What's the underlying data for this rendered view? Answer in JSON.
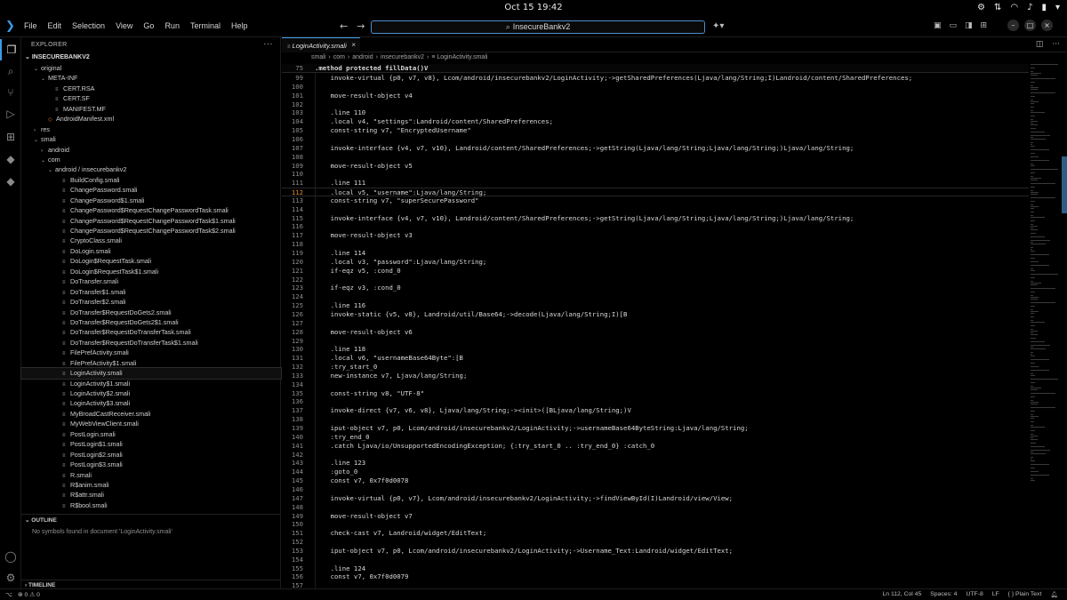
{
  "system": {
    "clock": "Oct 15  19:42",
    "tray_icons": [
      "notifications-icon",
      "network-icon",
      "wifi-icon",
      "volume-icon",
      "battery-icon",
      "menu-icon"
    ]
  },
  "menu": [
    "File",
    "Edit",
    "Selection",
    "View",
    "Go",
    "Run",
    "Terminal",
    "Help"
  ],
  "search": {
    "text": "InsecureBankv2"
  },
  "sidebar": {
    "header": "EXPLORER",
    "project": "INSECUREBANKV2",
    "tree": [
      {
        "label": "original",
        "depth": 1,
        "type": "folder",
        "open": true
      },
      {
        "label": "META-INF",
        "depth": 2,
        "type": "folder",
        "open": true
      },
      {
        "label": "CERT.RSA",
        "depth": 3,
        "type": "file"
      },
      {
        "label": "CERT.SF",
        "depth": 3,
        "type": "file"
      },
      {
        "label": "MANIFEST.MF",
        "depth": 3,
        "type": "file"
      },
      {
        "label": "AndroidManifest.xml",
        "depth": 2,
        "type": "xml"
      },
      {
        "label": "res",
        "depth": 1,
        "type": "folder",
        "open": false
      },
      {
        "label": "smali",
        "depth": 1,
        "type": "folder",
        "open": true
      },
      {
        "label": "android",
        "depth": 2,
        "type": "folder",
        "open": false
      },
      {
        "label": "com",
        "depth": 2,
        "type": "folder",
        "open": true
      },
      {
        "label": "android / insecurebankv2",
        "depth": 3,
        "type": "folder",
        "open": true
      },
      {
        "label": "BuildConfig.smali",
        "depth": 4,
        "type": "file"
      },
      {
        "label": "ChangePassword.smali",
        "depth": 4,
        "type": "file"
      },
      {
        "label": "ChangePassword$1.smali",
        "depth": 4,
        "type": "file"
      },
      {
        "label": "ChangePassword$RequestChangePasswordTask.smali",
        "depth": 4,
        "type": "file"
      },
      {
        "label": "ChangePassword$RequestChangePasswordTask$1.smali",
        "depth": 4,
        "type": "file"
      },
      {
        "label": "ChangePassword$RequestChangePasswordTask$2.smali",
        "depth": 4,
        "type": "file"
      },
      {
        "label": "CryptoClass.smali",
        "depth": 4,
        "type": "file"
      },
      {
        "label": "DoLogin.smali",
        "depth": 4,
        "type": "file"
      },
      {
        "label": "DoLogin$RequestTask.smali",
        "depth": 4,
        "type": "file"
      },
      {
        "label": "DoLogin$RequestTask$1.smali",
        "depth": 4,
        "type": "file"
      },
      {
        "label": "DoTransfer.smali",
        "depth": 4,
        "type": "file"
      },
      {
        "label": "DoTransfer$1.smali",
        "depth": 4,
        "type": "file"
      },
      {
        "label": "DoTransfer$2.smali",
        "depth": 4,
        "type": "file"
      },
      {
        "label": "DoTransfer$RequestDoGets2.smali",
        "depth": 4,
        "type": "file"
      },
      {
        "label": "DoTransfer$RequestDoGets2$1.smali",
        "depth": 4,
        "type": "file"
      },
      {
        "label": "DoTransfer$RequestDoTransferTask.smali",
        "depth": 4,
        "type": "file"
      },
      {
        "label": "DoTransfer$RequestDoTransferTask$1.smali",
        "depth": 4,
        "type": "file"
      },
      {
        "label": "FilePrefActivity.smali",
        "depth": 4,
        "type": "file"
      },
      {
        "label": "FilePrefActivity$1.smali",
        "depth": 4,
        "type": "file"
      },
      {
        "label": "LoginActivity.smali",
        "depth": 4,
        "type": "file",
        "selected": true
      },
      {
        "label": "LoginActivity$1.smali",
        "depth": 4,
        "type": "file"
      },
      {
        "label": "LoginActivity$2.smali",
        "depth": 4,
        "type": "file"
      },
      {
        "label": "LoginActivity$3.smali",
        "depth": 4,
        "type": "file"
      },
      {
        "label": "MyBroadCastReceiver.smali",
        "depth": 4,
        "type": "file"
      },
      {
        "label": "MyWebViewClient.smali",
        "depth": 4,
        "type": "file"
      },
      {
        "label": "PostLogin.smali",
        "depth": 4,
        "type": "file"
      },
      {
        "label": "PostLogin$1.smali",
        "depth": 4,
        "type": "file"
      },
      {
        "label": "PostLogin$2.smali",
        "depth": 4,
        "type": "file"
      },
      {
        "label": "PostLogin$3.smali",
        "depth": 4,
        "type": "file"
      },
      {
        "label": "R.smali",
        "depth": 4,
        "type": "file"
      },
      {
        "label": "R$anim.smali",
        "depth": 4,
        "type": "file"
      },
      {
        "label": "R$attr.smali",
        "depth": 4,
        "type": "file"
      },
      {
        "label": "R$bool.smali",
        "depth": 4,
        "type": "file"
      }
    ],
    "outline_header": "OUTLINE",
    "outline_message": "No symbols found in document 'LoginActivity.smali'",
    "timeline_header": "TIMELINE"
  },
  "editor": {
    "tab_label": "LoginActivity.smali",
    "breadcrumb": [
      "smali",
      "com",
      "android",
      "insecurebankv2",
      "LoginActivity.smali"
    ],
    "sticky_line": {
      "num": "75",
      "text": ".method protected fillData()V"
    },
    "current_line": "112",
    "lines": [
      {
        "num": "99",
        "text": "    invoke-virtual {p0, v7, v8}, Lcom/android/insecurebankv2/LoginActivity;->getSharedPreferences(Ljava/lang/String;I)Landroid/content/SharedPreferences;"
      },
      {
        "num": "100",
        "text": ""
      },
      {
        "num": "101",
        "text": "    move-result-object v4"
      },
      {
        "num": "102",
        "text": ""
      },
      {
        "num": "103",
        "text": "    .line 110"
      },
      {
        "num": "104",
        "text": "    .local v4, \"settings\":Landroid/content/SharedPreferences;"
      },
      {
        "num": "105",
        "text": "    const-string v7, \"EncryptedUsername\""
      },
      {
        "num": "106",
        "text": ""
      },
      {
        "num": "107",
        "text": "    invoke-interface {v4, v7, v10}, Landroid/content/SharedPreferences;->getString(Ljava/lang/String;Ljava/lang/String;)Ljava/lang/String;"
      },
      {
        "num": "108",
        "text": ""
      },
      {
        "num": "109",
        "text": "    move-result-object v5"
      },
      {
        "num": "110",
        "text": ""
      },
      {
        "num": "111",
        "text": "    .line 111"
      },
      {
        "num": "112",
        "text": "    .local v5, \"username\":Ljava/lang/String;"
      },
      {
        "num": "113",
        "text": "    const-string v7, \"superSecurePassword\""
      },
      {
        "num": "114",
        "text": ""
      },
      {
        "num": "115",
        "text": "    invoke-interface {v4, v7, v10}, Landroid/content/SharedPreferences;->getString(Ljava/lang/String;Ljava/lang/String;)Ljava/lang/String;"
      },
      {
        "num": "116",
        "text": ""
      },
      {
        "num": "117",
        "text": "    move-result-object v3"
      },
      {
        "num": "118",
        "text": ""
      },
      {
        "num": "119",
        "text": "    .line 114"
      },
      {
        "num": "120",
        "text": "    .local v3, \"password\":Ljava/lang/String;"
      },
      {
        "num": "121",
        "text": "    if-eqz v5, :cond_0"
      },
      {
        "num": "122",
        "text": ""
      },
      {
        "num": "123",
        "text": "    if-eqz v3, :cond_0"
      },
      {
        "num": "124",
        "text": ""
      },
      {
        "num": "125",
        "text": "    .line 116"
      },
      {
        "num": "126",
        "text": "    invoke-static {v5, v8}, Landroid/util/Base64;->decode(Ljava/lang/String;I)[B"
      },
      {
        "num": "127",
        "text": ""
      },
      {
        "num": "128",
        "text": "    move-result-object v6"
      },
      {
        "num": "129",
        "text": ""
      },
      {
        "num": "130",
        "text": "    .line 118"
      },
      {
        "num": "131",
        "text": "    .local v6, \"usernameBase64Byte\":[B"
      },
      {
        "num": "132",
        "text": "    :try_start_0"
      },
      {
        "num": "133",
        "text": "    new-instance v7, Ljava/lang/String;"
      },
      {
        "num": "134",
        "text": ""
      },
      {
        "num": "135",
        "text": "    const-string v8, \"UTF-8\""
      },
      {
        "num": "136",
        "text": ""
      },
      {
        "num": "137",
        "text": "    invoke-direct {v7, v6, v8}, Ljava/lang/String;-><init>([BLjava/lang/String;)V"
      },
      {
        "num": "138",
        "text": ""
      },
      {
        "num": "139",
        "text": "    iput-object v7, p0, Lcom/android/insecurebankv2/LoginActivity;->usernameBase64ByteString:Ljava/lang/String;"
      },
      {
        "num": "140",
        "text": "    :try_end_0"
      },
      {
        "num": "141",
        "text": "    .catch Ljava/io/UnsupportedEncodingException; {:try_start_0 .. :try_end_0} :catch_0"
      },
      {
        "num": "142",
        "text": ""
      },
      {
        "num": "143",
        "text": "    .line 123"
      },
      {
        "num": "144",
        "text": "    :goto_0"
      },
      {
        "num": "145",
        "text": "    const v7, 0x7f0d0078"
      },
      {
        "num": "146",
        "text": ""
      },
      {
        "num": "147",
        "text": "    invoke-virtual {p0, v7}, Lcom/android/insecurebankv2/LoginActivity;->findViewById(I)Landroid/view/View;"
      },
      {
        "num": "148",
        "text": ""
      },
      {
        "num": "149",
        "text": "    move-result-object v7"
      },
      {
        "num": "150",
        "text": ""
      },
      {
        "num": "151",
        "text": "    check-cast v7, Landroid/widget/EditText;"
      },
      {
        "num": "152",
        "text": ""
      },
      {
        "num": "153",
        "text": "    iput-object v7, p0, Lcom/android/insecurebankv2/LoginActivity;->Username_Text:Landroid/widget/EditText;"
      },
      {
        "num": "154",
        "text": ""
      },
      {
        "num": "155",
        "text": "    .line 124"
      },
      {
        "num": "156",
        "text": "    const v7, 0x7f0d0079"
      },
      {
        "num": "157",
        "text": ""
      }
    ]
  },
  "statusbar": {
    "errors": "0",
    "warnings": "0",
    "position": "Ln 112, Col 45",
    "spaces": "Spaces: 4",
    "encoding": "UTF-8",
    "eol": "LF",
    "language": "Plain Text"
  },
  "colors": {
    "accent": "#3c9be6",
    "current_line_number": "#e38b2e",
    "background": "#000000"
  }
}
